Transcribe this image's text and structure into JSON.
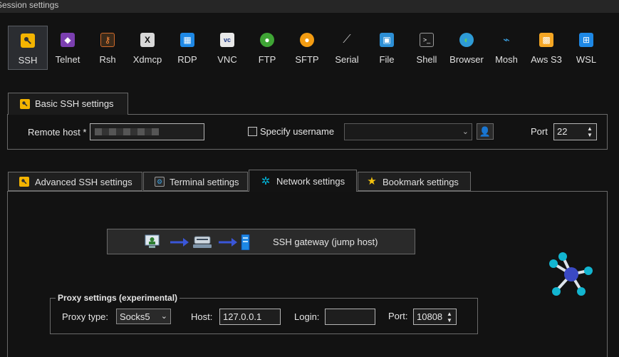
{
  "window": {
    "title": "Session settings"
  },
  "session_types": [
    {
      "label": "SSH",
      "icon": "ssh-key-icon",
      "selected": true
    },
    {
      "label": "Telnet",
      "icon": "telnet-icon"
    },
    {
      "label": "Rsh",
      "icon": "rsh-icon"
    },
    {
      "label": "Xdmcp",
      "icon": "xdmcp-icon"
    },
    {
      "label": "RDP",
      "icon": "rdp-icon"
    },
    {
      "label": "VNC",
      "icon": "vnc-icon"
    },
    {
      "label": "FTP",
      "icon": "ftp-icon"
    },
    {
      "label": "SFTP",
      "icon": "sftp-icon"
    },
    {
      "label": "Serial",
      "icon": "serial-icon"
    },
    {
      "label": "File",
      "icon": "file-icon"
    },
    {
      "label": "Shell",
      "icon": "shell-icon"
    },
    {
      "label": "Browser",
      "icon": "browser-icon"
    },
    {
      "label": "Mosh",
      "icon": "mosh-icon"
    },
    {
      "label": "Aws S3",
      "icon": "aws-s3-icon"
    },
    {
      "label": "WSL",
      "icon": "wsl-icon"
    }
  ],
  "basic": {
    "tab_label": "Basic SSH settings",
    "remote_host_label": "Remote host *",
    "remote_host_value": "",
    "specify_username_label": "Specify username",
    "specify_username_checked": false,
    "username_value": "",
    "port_label": "Port",
    "port_value": "22"
  },
  "tabs": [
    {
      "label": "Advanced SSH settings",
      "icon": "key-icon"
    },
    {
      "label": "Terminal settings",
      "icon": "terminal-icon"
    },
    {
      "label": "Network settings",
      "icon": "network-icon",
      "active": true
    },
    {
      "label": "Bookmark settings",
      "icon": "star-icon"
    }
  ],
  "network": {
    "gateway_label": "SSH gateway (jump host)",
    "proxy_group_label": "Proxy settings (experimental)",
    "proxy_type_label": "Proxy type:",
    "proxy_type_value": "Socks5",
    "host_label": "Host:",
    "host_value": "127.0.0.1",
    "login_label": "Login:",
    "login_value": "",
    "port_label": "Port:",
    "port_value": "10808"
  },
  "colors": {
    "accent": "#00b4d8",
    "node_blue": "#3a49c4",
    "toolbar_bg": "#121212"
  }
}
